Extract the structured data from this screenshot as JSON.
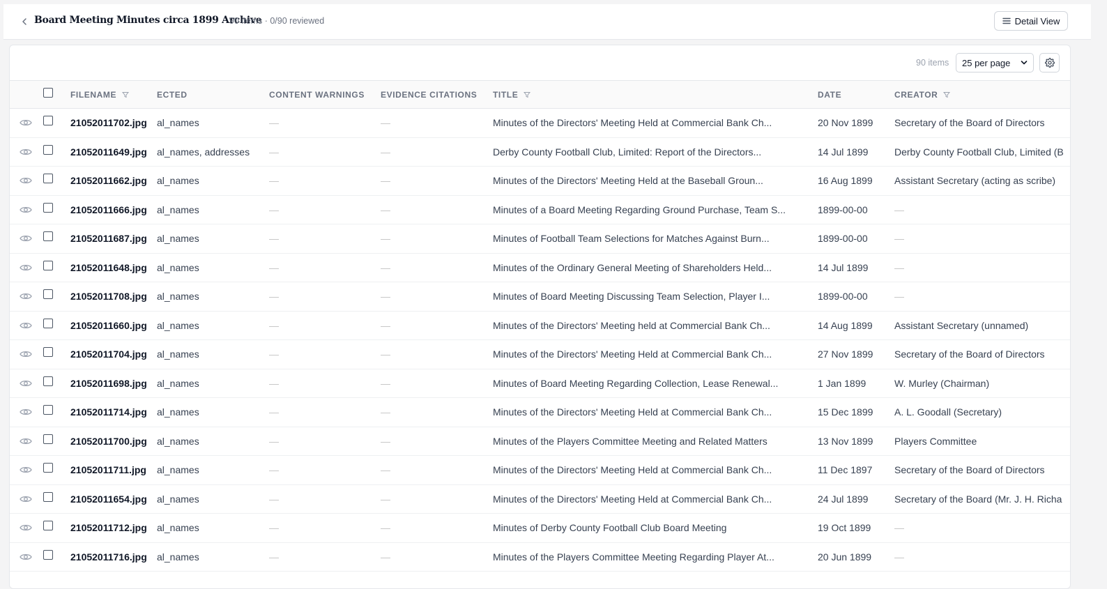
{
  "header": {
    "title": "Board Meeting Minutes circa 1899 Archive",
    "subtitle": "90 items · 0/90 reviewed",
    "detail_view_label": "Detail View"
  },
  "toolbar": {
    "items_count": "90 items",
    "per_page": "25 per page"
  },
  "columns": {
    "filename": "FILENAME",
    "selected": "ECTED",
    "content_warnings": "CONTENT WARNINGS",
    "evidence_citations": "EVIDENCE CITATIONS",
    "title": "TITLE",
    "date": "DATE",
    "creator": "CREATOR"
  },
  "rows": [
    {
      "filename": "21052011702.jpg",
      "selected": "al_names",
      "content_warnings": "—",
      "evidence_citations": "—",
      "title": "Minutes of the Directors' Meeting Held at Commercial Bank Ch...",
      "date": "20 Nov 1899",
      "creator": "Secretary of the Board of Directors"
    },
    {
      "filename": "21052011649.jpg",
      "selected": "al_names, addresses",
      "content_warnings": "—",
      "evidence_citations": "—",
      "title": "Derby County Football Club, Limited: Report of the Directors...",
      "date": "14 Jul 1899",
      "creator": "Derby County Football Club, Limited (B"
    },
    {
      "filename": "21052011662.jpg",
      "selected": "al_names",
      "content_warnings": "—",
      "evidence_citations": "—",
      "title": "Minutes of the Directors' Meeting Held at the Baseball Groun...",
      "date": "16 Aug 1899",
      "creator": "Assistant Secretary (acting as scribe)"
    },
    {
      "filename": "21052011666.jpg",
      "selected": "al_names",
      "content_warnings": "—",
      "evidence_citations": "—",
      "title": "Minutes of a Board Meeting Regarding Ground Purchase, Team S...",
      "date": "1899-00-00",
      "creator": "—"
    },
    {
      "filename": "21052011687.jpg",
      "selected": "al_names",
      "content_warnings": "—",
      "evidence_citations": "—",
      "title": "Minutes of Football Team Selections for Matches Against Burn...",
      "date": "1899-00-00",
      "creator": "—"
    },
    {
      "filename": "21052011648.jpg",
      "selected": "al_names",
      "content_warnings": "—",
      "evidence_citations": "—",
      "title": "Minutes of the Ordinary General Meeting of Shareholders Held...",
      "date": "14 Jul 1899",
      "creator": "—"
    },
    {
      "filename": "21052011708.jpg",
      "selected": "al_names",
      "content_warnings": "—",
      "evidence_citations": "—",
      "title": "Minutes of Board Meeting Discussing Team Selection, Player I...",
      "date": "1899-00-00",
      "creator": "—"
    },
    {
      "filename": "21052011660.jpg",
      "selected": "al_names",
      "content_warnings": "—",
      "evidence_citations": "—",
      "title": "Minutes of the Directors' Meeting held at Commercial Bank Ch...",
      "date": "14 Aug 1899",
      "creator": "Assistant Secretary (unnamed)"
    },
    {
      "filename": "21052011704.jpg",
      "selected": "al_names",
      "content_warnings": "—",
      "evidence_citations": "—",
      "title": "Minutes of the Directors' Meeting Held at Commercial Bank Ch...",
      "date": "27 Nov 1899",
      "creator": "Secretary of the Board of Directors"
    },
    {
      "filename": "21052011698.jpg",
      "selected": "al_names",
      "content_warnings": "—",
      "evidence_citations": "—",
      "title": "Minutes of Board Meeting Regarding Collection, Lease Renewal...",
      "date": "1 Jan 1899",
      "creator": "W. Murley (Chairman)"
    },
    {
      "filename": "21052011714.jpg",
      "selected": "al_names",
      "content_warnings": "—",
      "evidence_citations": "—",
      "title": "Minutes of the Directors' Meeting Held at Commercial Bank Ch...",
      "date": "15 Dec 1899",
      "creator": "A. L. Goodall (Secretary)"
    },
    {
      "filename": "21052011700.jpg",
      "selected": "al_names",
      "content_warnings": "—",
      "evidence_citations": "—",
      "title": "Minutes of the Players Committee Meeting and Related Matters",
      "date": "13 Nov 1899",
      "creator": "Players Committee"
    },
    {
      "filename": "21052011711.jpg",
      "selected": "al_names",
      "content_warnings": "—",
      "evidence_citations": "—",
      "title": "Minutes of the Directors' Meeting Held at Commercial Bank Ch...",
      "date": "11 Dec 1897",
      "creator": "Secretary of the Board of Directors"
    },
    {
      "filename": "21052011654.jpg",
      "selected": "al_names",
      "content_warnings": "—",
      "evidence_citations": "—",
      "title": "Minutes of the Directors' Meeting Held at Commercial Bank Ch...",
      "date": "24 Jul 1899",
      "creator": "Secretary of the Board (Mr. J. H. Richa"
    },
    {
      "filename": "21052011712.jpg",
      "selected": "al_names",
      "content_warnings": "—",
      "evidence_citations": "—",
      "title": "Minutes of Derby County Football Club Board Meeting",
      "date": "19 Oct 1899",
      "creator": "—"
    },
    {
      "filename": "21052011716.jpg",
      "selected": "al_names",
      "content_warnings": "—",
      "evidence_citations": "—",
      "title": "Minutes of the Players Committee Meeting Regarding Player At...",
      "date": "20 Jun 1899",
      "creator": "—"
    }
  ]
}
